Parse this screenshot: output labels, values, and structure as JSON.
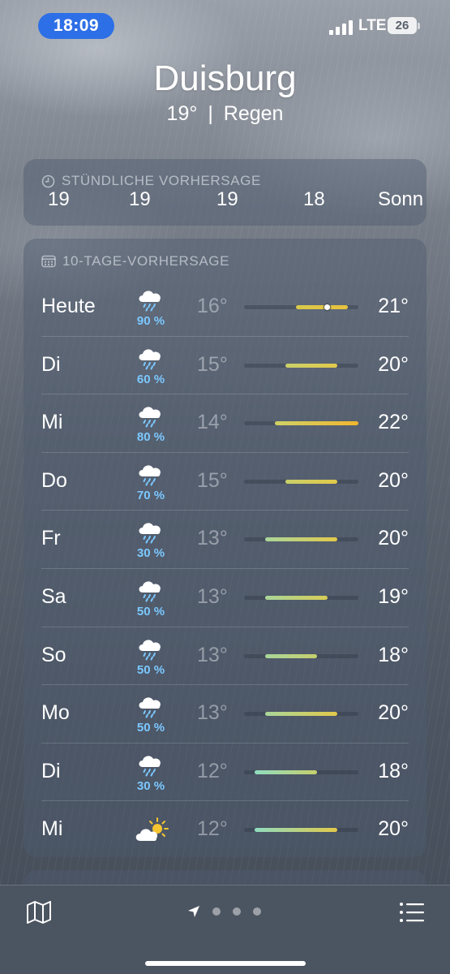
{
  "status_bar": {
    "time": "18:09",
    "network": "LTE",
    "battery": "26"
  },
  "header": {
    "city": "Duisburg",
    "temperature": "19°",
    "separator": "|",
    "condition": "Regen"
  },
  "hourly": {
    "title": "STÜNDLICHE VORHERSAGE",
    "icon": "clock-icon",
    "values": [
      "19",
      "19",
      "19",
      "18",
      "Sonn"
    ]
  },
  "daily": {
    "title": "10-TAGE-VORHERSAGE",
    "icon": "calendar-icon",
    "days": [
      {
        "name": "Heute",
        "icon": "rain-cloud-icon",
        "precip": "90 %",
        "low": "16°",
        "high": "21°",
        "current_marker": true,
        "colors": [
          "#d8c94a",
          "#e8c23c"
        ]
      },
      {
        "name": "Di",
        "icon": "rain-cloud-icon",
        "precip": "60 %",
        "low": "15°",
        "high": "20°",
        "colors": [
          "#c9d06a",
          "#e2c94a"
        ]
      },
      {
        "name": "Mi",
        "icon": "rain-cloud-icon",
        "precip": "80 %",
        "low": "14°",
        "high": "22°",
        "colors": [
          "#cfd166",
          "#f0b62e"
        ]
      },
      {
        "name": "Do",
        "icon": "rain-cloud-icon",
        "precip": "70 %",
        "low": "15°",
        "high": "20°",
        "colors": [
          "#c9d06a",
          "#e2c94a"
        ]
      },
      {
        "name": "Fr",
        "icon": "rain-cloud-icon",
        "precip": "30 %",
        "low": "13°",
        "high": "20°",
        "colors": [
          "#a9d69a",
          "#e2c94a"
        ]
      },
      {
        "name": "Sa",
        "icon": "rain-cloud-icon",
        "precip": "50 %",
        "low": "13°",
        "high": "19°",
        "colors": [
          "#a9d69a",
          "#d7cc56"
        ]
      },
      {
        "name": "So",
        "icon": "rain-cloud-icon",
        "precip": "50 %",
        "low": "13°",
        "high": "18°",
        "colors": [
          "#a9d69a",
          "#c6cf6c"
        ]
      },
      {
        "name": "Mo",
        "icon": "rain-cloud-icon",
        "precip": "50 %",
        "low": "13°",
        "high": "20°",
        "colors": [
          "#a9d69a",
          "#e2c94a"
        ]
      },
      {
        "name": "Di",
        "icon": "rain-cloud-icon",
        "precip": "30 %",
        "low": "12°",
        "high": "18°",
        "colors": [
          "#8fdcc0",
          "#c6cf6c"
        ]
      },
      {
        "name": "Mi",
        "icon": "partly-sunny-icon",
        "precip": "",
        "low": "12°",
        "high": "20°",
        "colors": [
          "#8fdcc0",
          "#e2c94a"
        ]
      }
    ],
    "range_min": 11,
    "range_max": 22
  },
  "bottom_bar": {
    "map_icon": "map-icon",
    "location_icon": "location-arrow-icon",
    "page_count": 3,
    "list_icon": "list-icon"
  },
  "colors": {
    "time_pill": "#2d6fe6",
    "precip_text": "#7cc8ff"
  }
}
